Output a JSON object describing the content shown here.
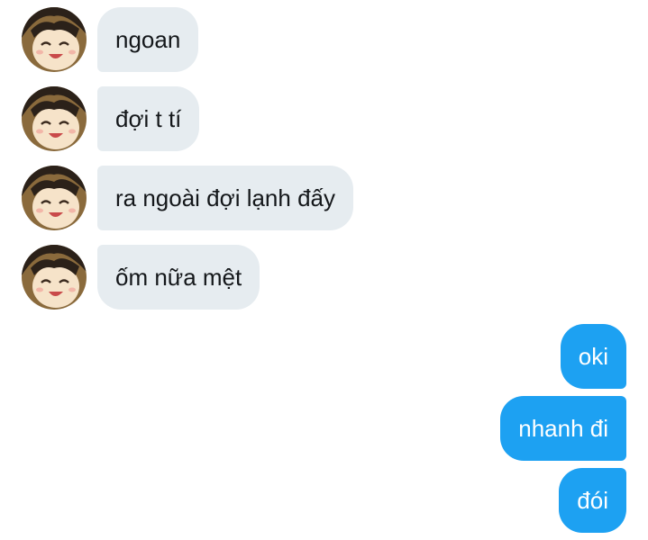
{
  "conversation": {
    "incoming": [
      {
        "text": "ngoan"
      },
      {
        "text": "đợi t tí"
      },
      {
        "text": "ra ngoài đợi lạnh đấy"
      },
      {
        "text": "ốm nữa mệt"
      }
    ],
    "outgoing": [
      {
        "text": "oki"
      },
      {
        "text": "nhanh đi"
      },
      {
        "text": "đói"
      }
    ]
  },
  "colors": {
    "incoming_bubble": "#e6ecf0",
    "incoming_text": "#14171a",
    "outgoing_bubble": "#1da1f2",
    "outgoing_text": "#ffffff"
  },
  "icons": {
    "avatar": "anime-character-avatar-icon"
  }
}
